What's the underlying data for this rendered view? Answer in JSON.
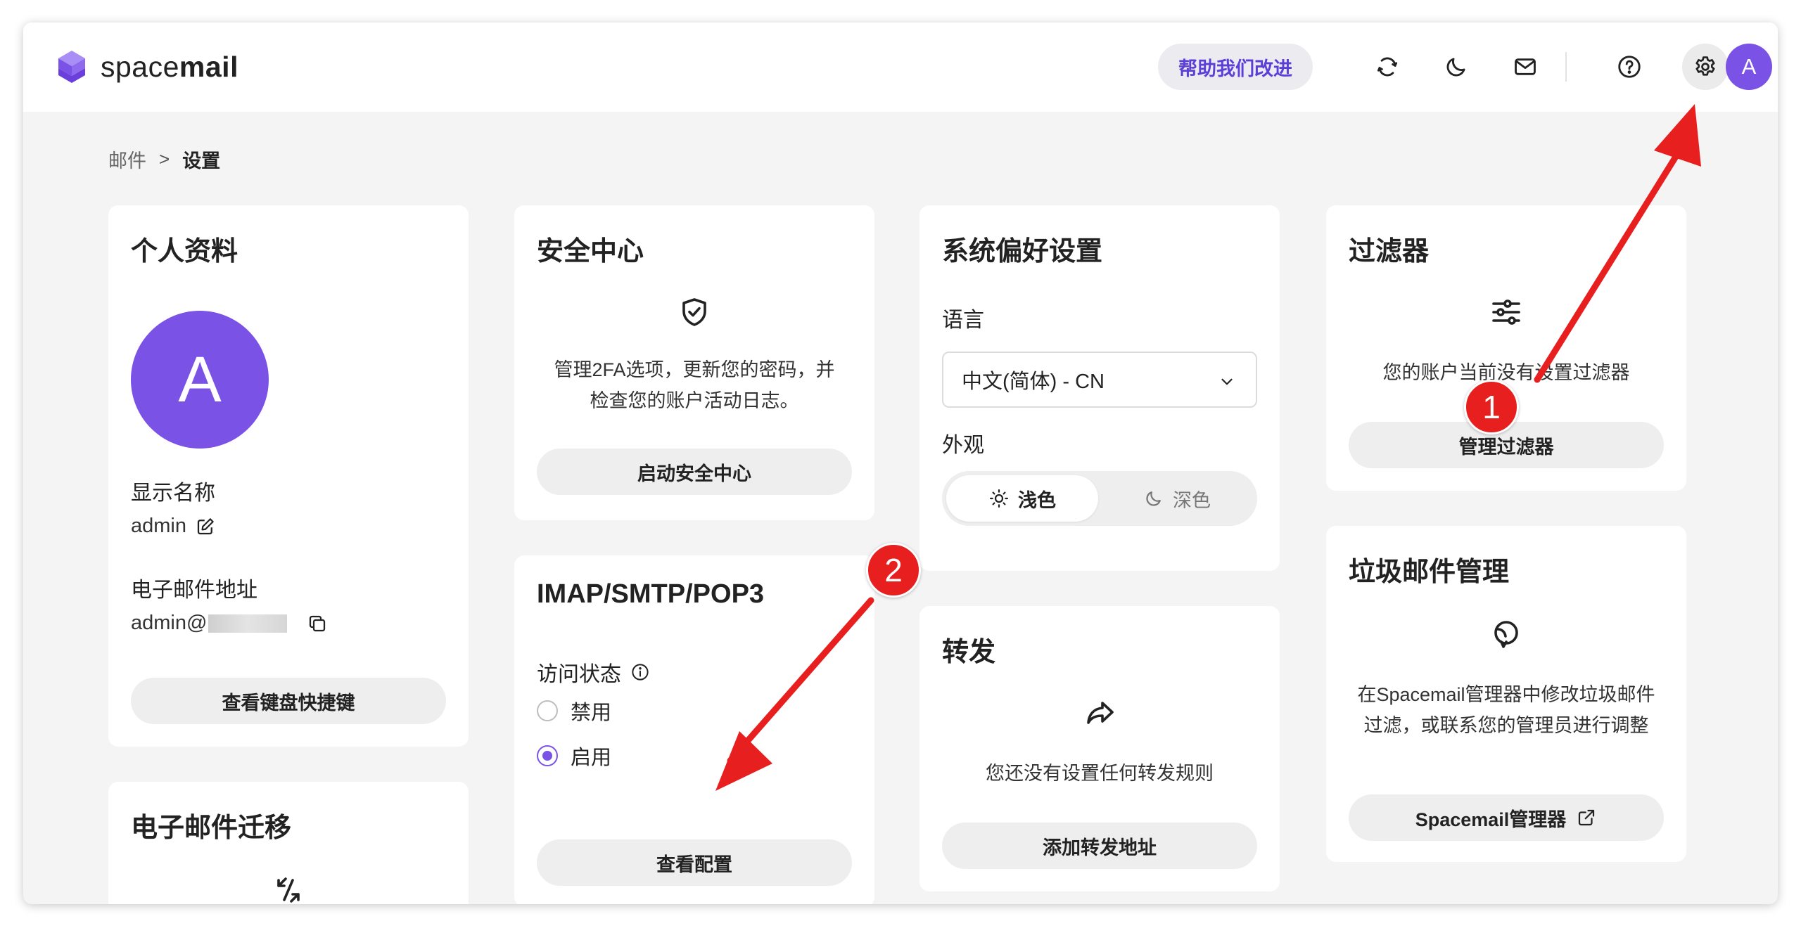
{
  "app": {
    "logo_text_light": "space",
    "logo_text_bold": "mail",
    "help_label": "帮助我们改进",
    "avatar_letter": "A",
    "accent": "#7b52e6",
    "icons": [
      "sync-icon",
      "moon-icon",
      "mail-icon",
      "help-circle-icon",
      "gear-icon"
    ]
  },
  "breadcrumb": {
    "root": "邮件",
    "separator": ">",
    "current": "设置"
  },
  "profile": {
    "title": "个人资料",
    "avatar_letter": "A",
    "display_name_label": "显示名称",
    "display_name_value": "admin",
    "email_label": "电子邮件地址",
    "email_value": "admin@",
    "shortcut_button": "查看键盘快捷键"
  },
  "migration": {
    "title": "电子邮件迁移"
  },
  "security": {
    "title": "安全中心",
    "desc_line1": "管理2FA选项，更新您的密码，并",
    "desc_line2": "检查您的账户活动日志。",
    "button": "启动安全中心"
  },
  "imap": {
    "title": "IMAP/SMTP/POP3",
    "access_label": "访问状态",
    "options": [
      {
        "label": "禁用",
        "checked": false
      },
      {
        "label": "启用",
        "checked": true
      }
    ],
    "button": "查看配置"
  },
  "preferences": {
    "title": "系统偏好设置",
    "language_label": "语言",
    "language_value": "中文(简体) - CN",
    "appearance_label": "外观",
    "appearance_light": "浅色",
    "appearance_dark": "深色",
    "appearance_selected": "浅色"
  },
  "forwarding": {
    "title": "转发",
    "empty_text": "您还没有设置任何转发规则",
    "button": "添加转发地址"
  },
  "filters": {
    "title": "过滤器",
    "empty_text": "您的账户当前没有设置过滤器",
    "button": "管理过滤器"
  },
  "spam": {
    "title": "垃圾邮件管理",
    "desc_line1": "在Spacemail管理器中修改垃圾邮件",
    "desc_line2": "过滤，或联系您的管理员进行调整",
    "button": "Spacemail管理器"
  },
  "annotations": {
    "badge_1": "1",
    "badge_2": "2",
    "color": "#e81f1f"
  }
}
